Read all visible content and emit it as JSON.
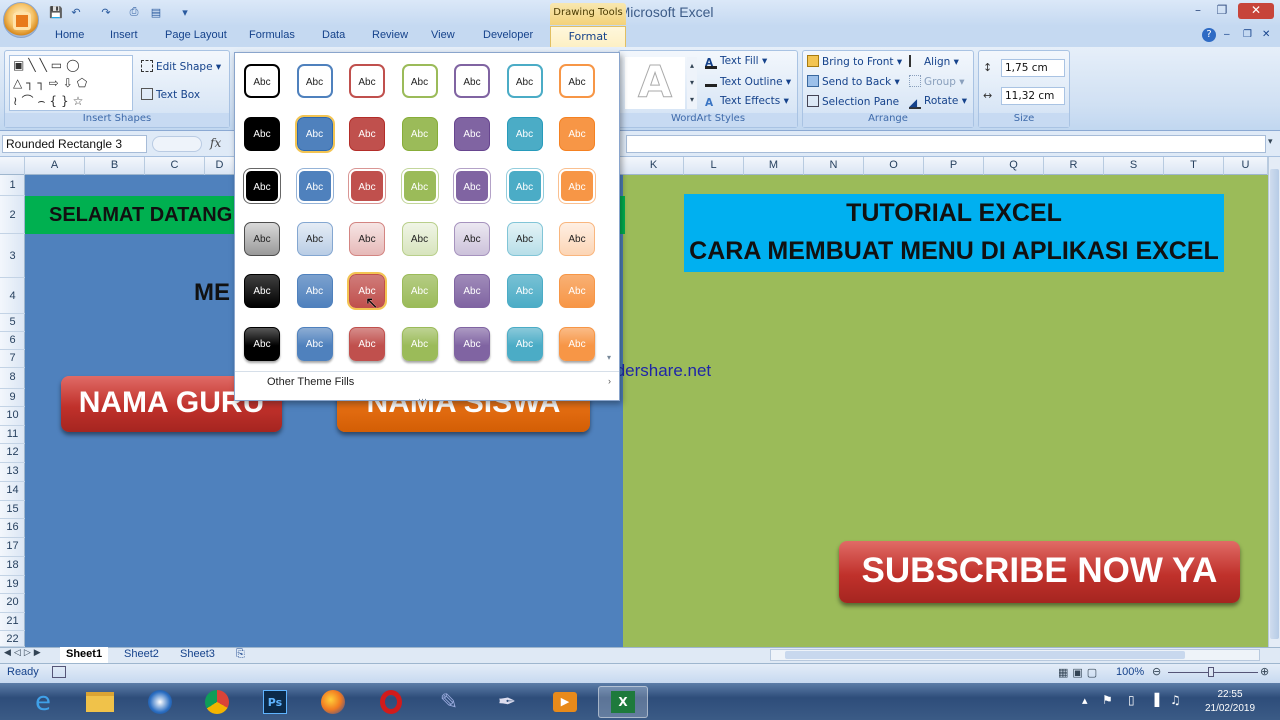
{
  "window": {
    "title": "Book1 - Microsoft Excel",
    "contextual_tab_group": "Drawing Tools"
  },
  "ribbon_tabs": [
    "Home",
    "Insert",
    "Page Layout",
    "Formulas",
    "Data",
    "Review",
    "View",
    "Developer",
    "Format"
  ],
  "ribbon": {
    "insert_shapes": {
      "edit_shape": "Edit Shape",
      "text_box": "Text Box",
      "label": "Insert Shapes"
    },
    "wordart": {
      "label": "WordArt Styles",
      "text_fill": "Text Fill",
      "text_outline": "Text Outline",
      "text_effects": "Text Effects",
      "preview": "A"
    },
    "arrange": {
      "label": "Arrange",
      "bring_to_front": "Bring to Front",
      "send_to_back": "Send to Back",
      "selection_pane": "Selection Pane",
      "align": "Align",
      "group": "Group",
      "rotate": "Rotate"
    },
    "size": {
      "label": "Size",
      "height": "1,75 cm",
      "width": "11,32 cm"
    }
  },
  "formula_bar": {
    "name_box": "Rounded Rectangle 3",
    "fx": "fx"
  },
  "columns": [
    "A",
    "B",
    "C",
    "D",
    "K",
    "L",
    "M",
    "N",
    "O",
    "P",
    "Q",
    "R",
    "S",
    "T",
    "U"
  ],
  "rows": [
    "1",
    "2",
    "3",
    "4",
    "5",
    "6",
    "7",
    "8",
    "9",
    "10",
    "11",
    "12",
    "13",
    "14",
    "15",
    "16",
    "17",
    "18",
    "19",
    "20",
    "21",
    "22"
  ],
  "sheet": {
    "welcome": "SELAMAT DATANG",
    "menu_fragment": "ME",
    "btn_guru": "NAMA GURU",
    "btn_siswa": "NAMA SISWA",
    "tutorial_line1": "TUTORIAL EXCEL",
    "tutorial_line2": "CARA MEMBUAT MENU DI APLIKASI EXCEL",
    "watermark": "www.thundershare.net",
    "subscribe": "SUBSCRIBE NOW YA"
  },
  "shape_styles_gallery": {
    "swatch_label": "Abc",
    "other_theme_fills": "Other Theme Fills",
    "colors": [
      "#000000",
      "#4f81bd",
      "#c0504d",
      "#9bbb59",
      "#8064a2",
      "#4bacc6",
      "#f79646"
    ]
  },
  "sheet_tabs": [
    "Sheet1",
    "Sheet2",
    "Sheet3"
  ],
  "status": {
    "ready": "Ready",
    "zoom": "100%"
  },
  "clock": {
    "time": "22:55",
    "date": "21/02/2019"
  }
}
